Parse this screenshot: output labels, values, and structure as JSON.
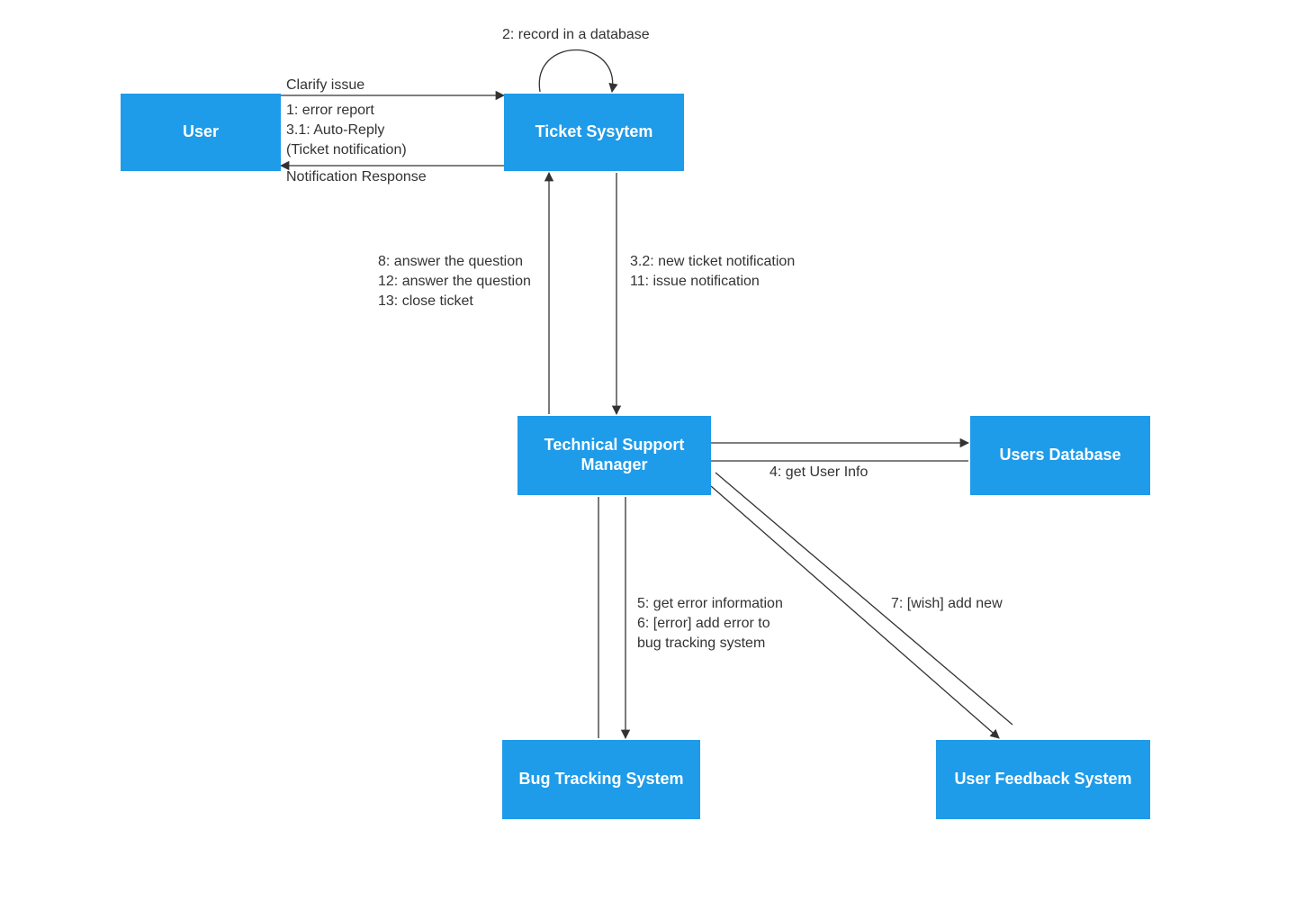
{
  "nodes": {
    "user": "User",
    "ticket_system": "Ticket Sysytem",
    "support_manager": "Technical Support Manager",
    "users_database": "Users Database",
    "bug_tracking": "Bug Tracking System",
    "feedback_system": "User Feedback System"
  },
  "edges": {
    "user_ticket_top": "Clarify issue",
    "user_ticket_mid_1": "1: error report",
    "user_ticket_mid_2": "3.1: Auto-Reply",
    "user_ticket_mid_3": "(Ticket notification)",
    "user_ticket_bot": "Notification Response",
    "self_loop": "2: record in a database",
    "ticket_to_mgr_1": "3.2: new ticket notification",
    "ticket_to_mgr_2": "11: issue notification",
    "mgr_to_ticket_1": "8: answer the question",
    "mgr_to_ticket_2": "12: answer the question",
    "mgr_to_ticket_3": "13: close ticket",
    "mgr_db": "4: get User Info",
    "mgr_bug_1": "5: get error information",
    "mgr_bug_2": "6: [error] add error to",
    "mgr_bug_3": "bug tracking system",
    "mgr_feedback": "7: [wish] add new"
  }
}
